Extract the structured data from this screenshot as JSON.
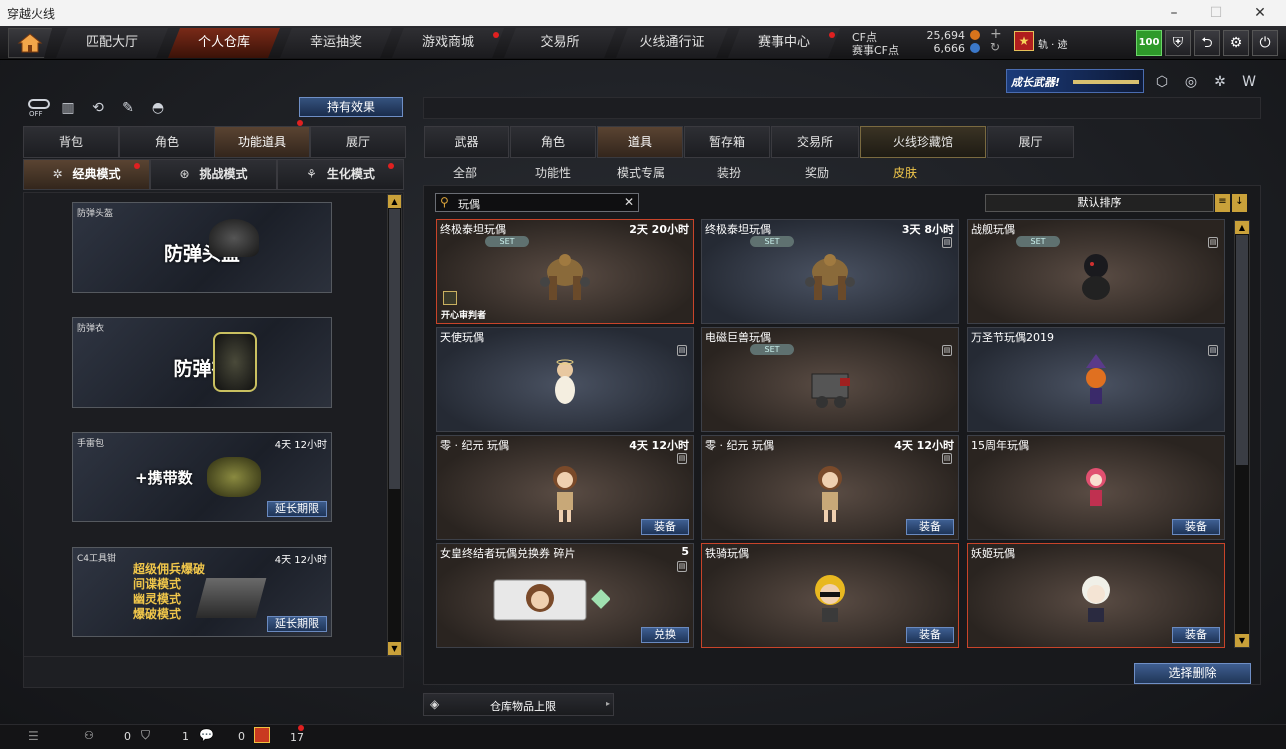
{
  "window": {
    "title": "穿越火线"
  },
  "topnav": {
    "tabs": [
      {
        "label": "匹配大厅",
        "badge": false
      },
      {
        "label": "个人仓库",
        "badge": false,
        "active": true
      },
      {
        "label": "幸运抽奖",
        "badge": false
      },
      {
        "label": "游戏商城",
        "badge": true
      },
      {
        "label": "交易所",
        "badge": false
      },
      {
        "label": "火线通行证",
        "badge": false
      },
      {
        "label": "赛事中心",
        "badge": true
      }
    ],
    "cf_label": "CF点",
    "cf_value": "25,694",
    "event_cf_label": "赛事CF点",
    "event_cf_value": "6,666",
    "player_name": "轨 · 迹",
    "level_badge": "100"
  },
  "promo": {
    "text": "成长武器!"
  },
  "left": {
    "effect_button": "持有效果",
    "icon_off": "OFF",
    "tabs": [
      "背包",
      "角色",
      "功能道具",
      "展厅"
    ],
    "active_tab": "功能道具",
    "modes": [
      "经典模式",
      "挑战模式",
      "生化模式"
    ],
    "items": [
      {
        "label": "防弹头盔",
        "title": "防弹头盔",
        "time": ""
      },
      {
        "label": "防弹衣",
        "title": "防弹衣",
        "time": ""
      },
      {
        "label": "手雷包",
        "title": "+携带数",
        "time": "4天 12小时",
        "button": "延长期限"
      },
      {
        "label": "C4工具钳",
        "lines": [
          "超级佣兵爆破",
          "间谍模式",
          "幽灵模式",
          "爆破模式"
        ],
        "time": "4天 12小时",
        "button": "延长期限"
      }
    ]
  },
  "right": {
    "tabs": [
      "武器",
      "角色",
      "道具",
      "暂存箱",
      "交易所",
      "火线珍藏馆",
      "展厅"
    ],
    "active_tab": "道具",
    "subtabs": [
      "全部",
      "功能性",
      "模式专属",
      "装扮",
      "奖励",
      "皮肤"
    ],
    "active_subtab": "皮肤",
    "search": {
      "value": "玩偶"
    },
    "sort": {
      "label": "默认排序"
    },
    "cards": [
      {
        "name": "终极泰坦玩偶",
        "time": "2天 20小时",
        "set": "SET",
        "lock": false,
        "button": "",
        "bg": "brown",
        "gold": true,
        "tag": "开心审判者",
        "fig": "titan"
      },
      {
        "name": "终极泰坦玩偶",
        "time": "3天 8小时",
        "set": "SET",
        "lock": true,
        "button": "",
        "bg": "blue",
        "gold": false,
        "fig": "titan"
      },
      {
        "name": "战舰玩偶",
        "time": "",
        "set": "SET",
        "lock": true,
        "button": "",
        "bg": "brown",
        "gold": false,
        "fig": "dark"
      },
      {
        "name": "天使玩偶",
        "time": "",
        "set": "",
        "lock": true,
        "button": "",
        "bg": "blue",
        "gold": false,
        "fig": "angel"
      },
      {
        "name": "电磁巨兽玩偶",
        "time": "",
        "set": "SET",
        "lock": true,
        "button": "",
        "bg": "brown",
        "gold": false,
        "fig": "mech"
      },
      {
        "name": "万圣节玩偶2019",
        "time": "",
        "set": "",
        "lock": true,
        "button": "",
        "bg": "blue",
        "gold": false,
        "fig": "pumpkin"
      },
      {
        "name": "零 · 纪元 玩偶",
        "time": "4天 12小时",
        "set": "",
        "lock": true,
        "button": "装备",
        "bg": "brown",
        "gold": false,
        "fig": "girl"
      },
      {
        "name": "零 · 纪元 玩偶",
        "time": "4天 12小时",
        "set": "",
        "lock": true,
        "button": "装备",
        "bg": "brown",
        "gold": false,
        "fig": "girl"
      },
      {
        "name": "15周年玩偶",
        "time": "",
        "set": "",
        "lock": false,
        "button": "装备",
        "bg": "brown",
        "gold": false,
        "fig": "pink"
      },
      {
        "name": "女皇终结者玩偶兑换券 碎片",
        "time": "5",
        "set": "",
        "lock": true,
        "button": "兑换",
        "bg": "brown",
        "gold": false,
        "fig": "ticket"
      },
      {
        "name": "铁骑玩偶",
        "time": "",
        "set": "",
        "lock": false,
        "button": "装备",
        "bg": "brown",
        "gold": true,
        "fig": "blonde"
      },
      {
        "name": "妖姬玩偶",
        "time": "",
        "set": "",
        "lock": false,
        "button": "装备",
        "bg": "brown",
        "gold": true,
        "fig": "whitehair"
      }
    ],
    "select_delete": "选择删除",
    "storage_limit": "仓库物品上限"
  },
  "status": {
    "counts": [
      "0",
      "1",
      "0",
      "17"
    ]
  }
}
